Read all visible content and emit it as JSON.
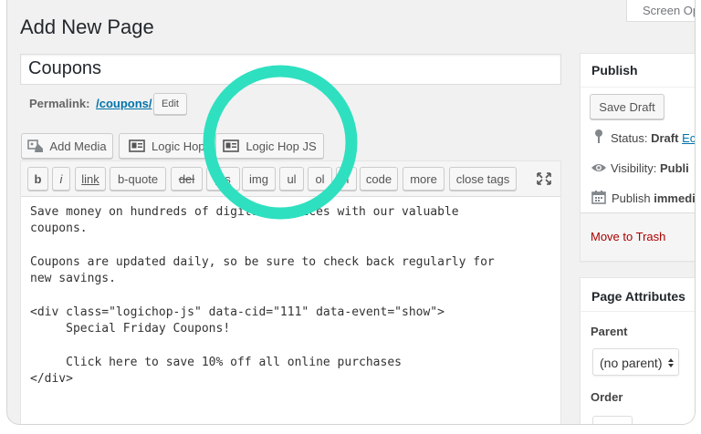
{
  "screen_options": "Screen Op",
  "page_heading": "Add New Page",
  "title_value": "Coupons",
  "permalink": {
    "label": "Permalink:",
    "slug": "/coupons/",
    "edit": "Edit"
  },
  "media_buttons": {
    "add_media": "Add Media",
    "logic_hop": "Logic Hop",
    "logic_hop_js": "Logic Hop JS"
  },
  "quicktags": [
    "b",
    "i",
    "link",
    "b-quote",
    "del",
    "ins",
    "img",
    "ul",
    "ol",
    "li",
    "code",
    "more",
    "close tags"
  ],
  "editor_lines": [
    "Save money on hundreds of digital services with our valuable",
    "coupons.",
    "",
    "Coupons are updated daily, so be sure to check back regularly for",
    "new savings.",
    "",
    "<div class=\"logichop-js\" data-cid=\"111\" data-event=\"show\">",
    "     Special Friday Coupons!",
    "",
    "     Click here to save 10% off all online purchases",
    "</div>"
  ],
  "publish": {
    "title": "Publish",
    "save_draft": "Save Draft",
    "status_label": "Status:",
    "status_value": "Draft",
    "status_edit": "Ec",
    "visibility_label": "Visibility:",
    "visibility_value": "Publi",
    "publish_label": "Publish",
    "publish_value": "immedi",
    "move_to_trash": "Move to Trash"
  },
  "page_attributes": {
    "title": "Page Attributes",
    "parent_label": "Parent",
    "parent_value": "(no parent)",
    "order_label": "Order"
  },
  "colors": {
    "highlight_ring": "#2ee0c0",
    "link": "#0073aa",
    "trash": "#a00"
  },
  "icons": [
    "add-media-icon",
    "logic-hop-icon",
    "logic-hop-js-icon",
    "fullscreen-icon",
    "pin-icon",
    "eye-icon",
    "calendar-icon",
    "select-arrows-icon"
  ]
}
